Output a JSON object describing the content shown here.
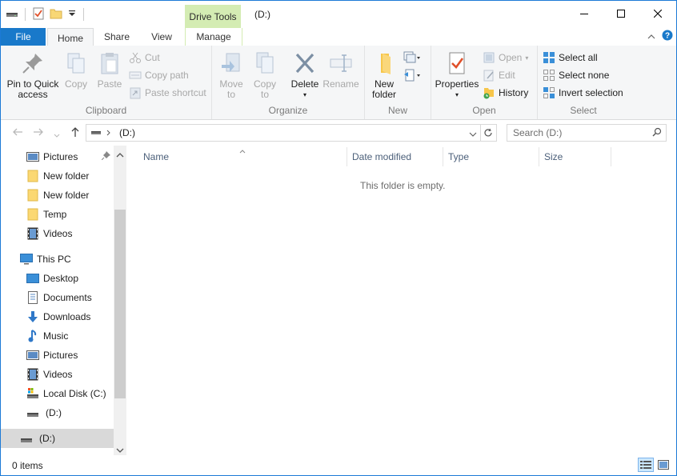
{
  "window": {
    "title": "(D:)"
  },
  "context_tab": {
    "label": "Drive Tools"
  },
  "tabs": {
    "file": "File",
    "home": "Home",
    "share": "Share",
    "view": "View",
    "manage": "Manage"
  },
  "ribbon": {
    "clipboard": {
      "label": "Clipboard",
      "pin_line1": "Pin to Quick",
      "pin_line2": "access",
      "copy": "Copy",
      "paste": "Paste",
      "cut": "Cut",
      "copy_path": "Copy path",
      "paste_shortcut": "Paste shortcut"
    },
    "organize": {
      "label": "Organize",
      "move_line1": "Move",
      "move_line2": "to",
      "copy_line1": "Copy",
      "copy_line2": "to",
      "delete": "Delete",
      "rename": "Rename"
    },
    "new": {
      "label": "New",
      "folder_line1": "New",
      "folder_line2": "folder"
    },
    "open": {
      "label": "Open",
      "properties": "Properties",
      "open": "Open",
      "edit": "Edit",
      "history": "History"
    },
    "select": {
      "label": "Select",
      "select_all": "Select all",
      "select_none": "Select none",
      "invert": "Invert selection"
    }
  },
  "address": {
    "path": "(D:)",
    "search_placeholder": "Search  (D:)"
  },
  "nav": {
    "quick": [
      "Pictures",
      "New folder",
      "New folder",
      "Temp",
      "Videos"
    ],
    "this_pc": "This PC",
    "pc_items": [
      "Desktop",
      "Documents",
      "Downloads",
      "Music",
      "Pictures",
      "Videos",
      "Local Disk (C:)",
      "(D:)"
    ],
    "drive_root": "(D:)"
  },
  "columns": {
    "name": "Name",
    "date": "Date modified",
    "type": "Type",
    "size": "Size"
  },
  "content": {
    "empty_message": "This folder is empty."
  },
  "status": {
    "count": "0 items"
  },
  "colors": {
    "accent": "#1979ca",
    "context_tab": "#d4ecb3",
    "selection": "#d9d9d9"
  }
}
